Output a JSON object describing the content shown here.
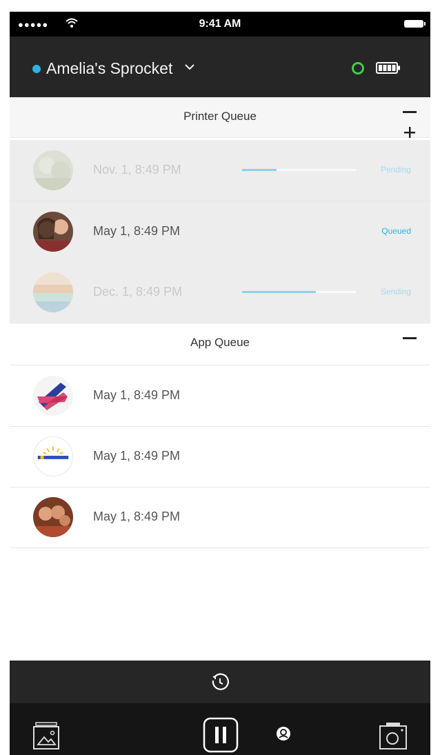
{
  "status_bar": {
    "signal": "●●●●●",
    "time": "9:41 AM"
  },
  "header": {
    "device_name": "Amelia's Sprocket"
  },
  "printer_queue": {
    "title": "Printer Queue",
    "items": [
      {
        "date": "Nov. 1, 8:49 PM",
        "status": "Pending",
        "progress": 0.3
      },
      {
        "date": "May 1, 8:49 PM",
        "status": "Queued",
        "progress": null
      },
      {
        "date": "Dec. 1, 8:49 PM",
        "status": "Sending",
        "progress": 0.65
      }
    ]
  },
  "app_queue": {
    "title": "App Queue",
    "items": [
      {
        "date": "May 1, 8:49 PM"
      },
      {
        "date": "May 1, 8:49 PM"
      },
      {
        "date": "May 1, 8:49 PM"
      }
    ]
  },
  "colors": {
    "accent": "#2ab4e6",
    "connected": "#3cd04a",
    "header_bg": "#262626",
    "nav_bg": "#151515"
  },
  "icons": {
    "wifi": "wifi-icon",
    "battery": "battery-icon",
    "chevron": "chevron-down-icon",
    "timer": "timer-icon",
    "gallery": "gallery-icon",
    "pause": "pause-icon",
    "user": "user-icon",
    "camera": "camera-icon"
  }
}
